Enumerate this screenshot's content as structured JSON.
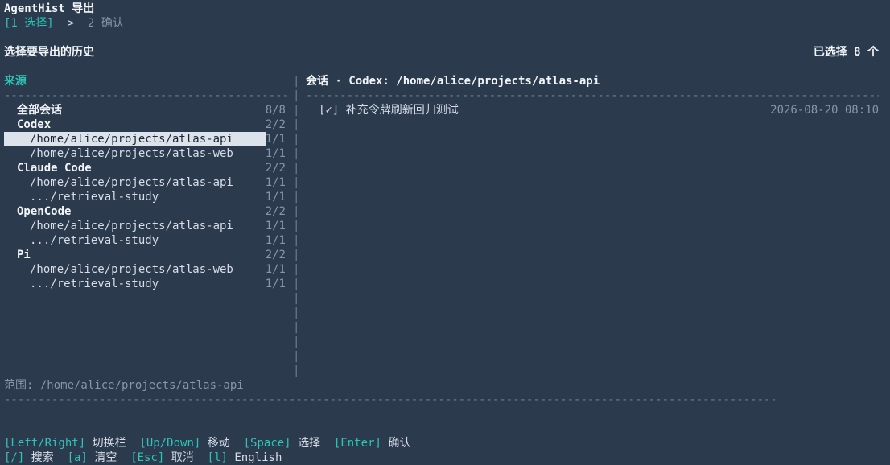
{
  "app": {
    "title": "AgentHist 导出"
  },
  "steps": {
    "current": "[1 选择]",
    "separator": ">",
    "next": "2 确认"
  },
  "section": {
    "title": "选择要导出的历史",
    "selected_count": "已选择 8 个"
  },
  "sources": {
    "header": "来源",
    "rows": [
      {
        "label": "全部会话",
        "count": "8/8",
        "kind": "group",
        "indent": 1
      },
      {
        "label": "Codex",
        "count": "2/2",
        "kind": "group",
        "indent": 1
      },
      {
        "label": "/home/alice/projects/atlas-api",
        "count": "1/1",
        "kind": "path",
        "indent": 2,
        "selected": true
      },
      {
        "label": "/home/alice/projects/atlas-web",
        "count": "1/1",
        "kind": "path",
        "indent": 2
      },
      {
        "label": "Claude Code",
        "count": "2/2",
        "kind": "group",
        "indent": 1
      },
      {
        "label": "/home/alice/projects/atlas-api",
        "count": "1/1",
        "kind": "path",
        "indent": 2
      },
      {
        "label": ".../retrieval-study",
        "count": "1/1",
        "kind": "path",
        "indent": 2
      },
      {
        "label": "OpenCode",
        "count": "2/2",
        "kind": "group",
        "indent": 1
      },
      {
        "label": "/home/alice/projects/atlas-api",
        "count": "1/1",
        "kind": "path",
        "indent": 2
      },
      {
        "label": ".../retrieval-study",
        "count": "1/1",
        "kind": "path",
        "indent": 2
      },
      {
        "label": "Pi",
        "count": "2/2",
        "kind": "group",
        "indent": 1
      },
      {
        "label": "/home/alice/projects/atlas-web",
        "count": "1/1",
        "kind": "path",
        "indent": 2
      },
      {
        "label": ".../retrieval-study",
        "count": "1/1",
        "kind": "path",
        "indent": 2
      }
    ]
  },
  "sessions": {
    "header": "会话 · Codex: /home/alice/projects/atlas-api",
    "items": [
      {
        "checkbox": "[✓]",
        "title": "补充令牌刷新回归测试",
        "time": "2026-08-20 08:10"
      }
    ]
  },
  "footer": {
    "scope": "范围: /home/alice/projects/atlas-api",
    "help_row1": [
      {
        "key": "[Left/Right]",
        "desc": "切换栏"
      },
      {
        "key": "[Up/Down]",
        "desc": "移动"
      },
      {
        "key": "[Space]",
        "desc": "选择"
      },
      {
        "key": "[Enter]",
        "desc": "确认"
      }
    ],
    "help_row2": [
      {
        "key": "[/]",
        "desc": "搜索"
      },
      {
        "key": "[a]",
        "desc": "清空"
      },
      {
        "key": "[Esc]",
        "desc": "取消"
      },
      {
        "key": "[l]",
        "desc": "English"
      }
    ]
  },
  "colors": {
    "background": "#2b3a4d",
    "accent": "#2ec4b6",
    "selection": "#dde3ea"
  }
}
